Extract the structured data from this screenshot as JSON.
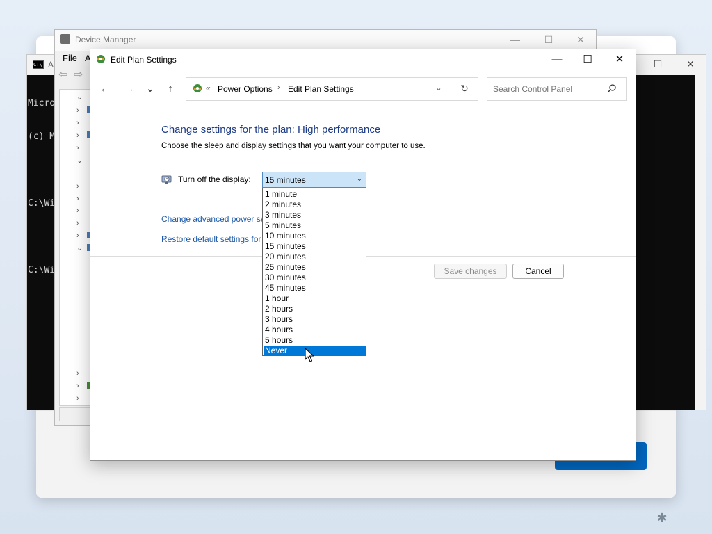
{
  "cmd_window": {
    "title": "A",
    "lines": [
      "Micro",
      "(c) M",
      "",
      "C:\\Wi",
      "",
      "C:\\Wi"
    ],
    "controls": {
      "maximize": "☐",
      "close": "✕"
    }
  },
  "device_manager": {
    "title": "Device Manager",
    "menu": [
      "File",
      "A"
    ],
    "controls": {
      "minimize": "—",
      "maximize": "☐",
      "close": "✕"
    }
  },
  "edit_plan": {
    "window_title": "Edit Plan Settings",
    "controls": {
      "minimize": "—",
      "maximize": "☐",
      "close": "✕"
    },
    "nav": {
      "back": "←",
      "forward": "→",
      "recent": "⌄",
      "up": "↑"
    },
    "address": {
      "separator": "«",
      "crumbs": [
        "Power Options",
        "Edit Plan Settings"
      ],
      "arrow": "›",
      "dropdown": "⌄",
      "refresh": "↻"
    },
    "search": {
      "placeholder": "Search Control Panel"
    },
    "heading": "Change settings for the plan: High performance",
    "description": "Choose the sleep and display settings that you want your computer to use.",
    "display_setting": {
      "label": "Turn off the display:",
      "selected": "15 minutes",
      "chevron": "⌄",
      "options": [
        "1 minute",
        "2 minutes",
        "3 minutes",
        "5 minutes",
        "10 minutes",
        "15 minutes",
        "20 minutes",
        "25 minutes",
        "30 minutes",
        "45 minutes",
        "1 hour",
        "2 hours",
        "3 hours",
        "4 hours",
        "5 hours",
        "Never"
      ],
      "highlighted": "Never"
    },
    "links": {
      "advanced": "Change advanced power se",
      "restore": "Restore default settings for t"
    },
    "buttons": {
      "save": "Save changes",
      "cancel": "Cancel"
    }
  },
  "setup": {
    "accessibility_icon": "✱"
  },
  "colors": {
    "accent": "#0067c0",
    "heading": "#1e3c85",
    "link": "#1e5aa8",
    "selection": "#0078d7"
  }
}
